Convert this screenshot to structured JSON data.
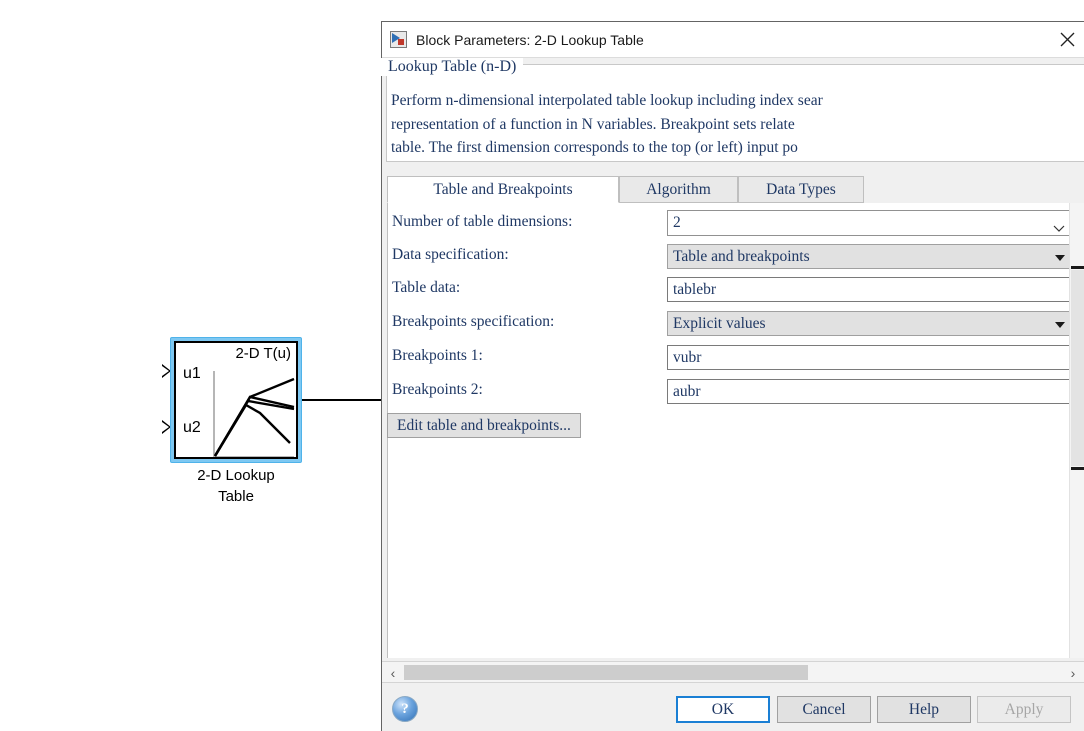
{
  "canvas": {
    "block": {
      "title": "2-D T(u)",
      "input1": "u1",
      "input2": "u2",
      "caption_line1": "2-D Lookup",
      "caption_line2": "Table",
      "selected": true,
      "selection_color": "#7ec8f2"
    }
  },
  "dialog": {
    "title": "Block Parameters: 2-D Lookup Table",
    "title_icon": "simulink-block-icon",
    "close_icon": "close-icon",
    "group": {
      "legend": "Lookup Table (n-D)",
      "description_lines": [
        "Perform n-dimensional interpolated table lookup including index sear",
        "representation of a function in N variables. Breakpoint sets relate",
        "table. The first dimension corresponds to the top (or left) input po"
      ]
    },
    "tabs": [
      {
        "label": "Table and Breakpoints",
        "active": true
      },
      {
        "label": "Algorithm",
        "active": false
      },
      {
        "label": "Data Types",
        "active": false
      }
    ],
    "fields": [
      {
        "label": "Number of table dimensions:",
        "value": "2",
        "type": "combo-white"
      },
      {
        "label": "Data specification:",
        "value": "Table and breakpoints",
        "type": "combo-gray"
      },
      {
        "label": "Table data:",
        "value": "tablebr",
        "type": "text"
      },
      {
        "label": "Breakpoints specification:",
        "value": "Explicit values",
        "type": "combo-gray"
      },
      {
        "label": "Breakpoints 1:",
        "value": "vubr",
        "type": "text"
      },
      {
        "label": "Breakpoints 2:",
        "value": "aubr",
        "type": "text"
      }
    ],
    "edit_button": "Edit table and breakpoints...",
    "scrollbars": {
      "h_left_arrow": "‹",
      "h_right_arrow": "›"
    },
    "help_icon_label": "?",
    "buttons": [
      {
        "label": "OK",
        "state": "default-focused"
      },
      {
        "label": "Cancel",
        "state": "normal"
      },
      {
        "label": "Help",
        "state": "normal"
      },
      {
        "label": "Apply",
        "state": "disabled"
      }
    ]
  },
  "colors": {
    "accent": "#1a7fd4",
    "dialog_bg": "#f0f0f0",
    "field_text": "#1f3864",
    "selection": "#7ec8f2"
  }
}
